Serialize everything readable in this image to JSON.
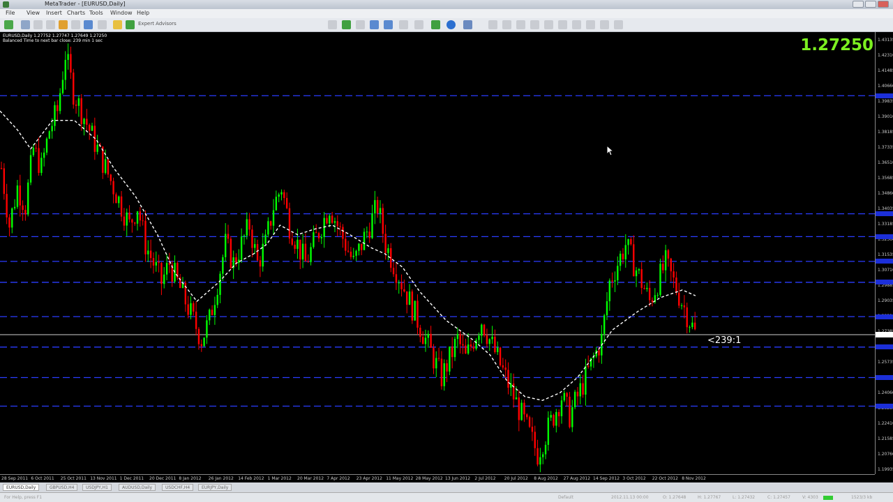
{
  "window": {
    "title": "MetaTrader - [EURUSD,Daily]",
    "menu": [
      "File",
      "View",
      "Insert",
      "Charts",
      "Tools",
      "Window",
      "Help"
    ],
    "toolbar_button": "Expert Advisors"
  },
  "chart_info": {
    "symbol_line": "EURUSD,Daily  1.27752 1.27747 1.27649 1.27250",
    "timer_line": "Balanced Time to next bar close: 239 min 1 sec",
    "big_price": "1.27250",
    "countdown": "<239:1"
  },
  "price_labels": [
    "1.43135",
    "1.42310",
    "1.41485",
    "1.40660",
    "1.39835",
    "1.39010",
    "1.38185",
    "1.37335",
    "1.36510",
    "1.35685",
    "1.34860",
    "1.34035",
    "1.33185",
    "1.32360",
    "1.31535",
    "1.30710",
    "1.29885",
    "1.29035",
    "1.28210",
    "1.27385",
    "1.26560",
    "1.25735",
    "1.24910",
    "1.24060",
    "1.23235",
    "1.22410",
    "1.21585",
    "1.20760",
    "1.19935"
  ],
  "time_labels": [
    "28 Sep 2011",
    "6 Oct 2011",
    "25 Oct 2011",
    "13 Nov 2011",
    "1 Dec 2011",
    "20 Dec 2011",
    "8 Jan 2012",
    "26 Jan 2012",
    "14 Feb 2012",
    "1 Mar 2012",
    "20 Mar 2012",
    "7 Apr 2012",
    "23 Apr 2012",
    "11 May 2012",
    "28 May 2012",
    "13 Jun 2012",
    "2 Jul 2012",
    "20 Jul 2012",
    "8 Aug 2012",
    "27 Aug 2012",
    "14 Sep 2012",
    "3 Oct 2012",
    "22 Oct 2012",
    "8 Nov 2012"
  ],
  "chart_data": {
    "type": "candlestick",
    "symbol": "EURUSD",
    "timeframe": "Daily",
    "current_price": 1.2725,
    "y_range": [
      1.1993,
      1.4314
    ],
    "horizontal_levels": [
      1.398,
      1.336,
      1.324,
      1.311,
      1.3,
      1.282,
      1.266,
      1.25,
      1.235
    ],
    "current_price_line": 1.2725,
    "moving_average_path": [
      [
        1.39,
        0
      ],
      [
        1.38,
        0.02
      ],
      [
        1.37,
        0.035
      ],
      [
        1.385,
        0.06
      ],
      [
        1.385,
        0.085
      ],
      [
        1.375,
        0.11
      ],
      [
        1.36,
        0.13
      ],
      [
        1.345,
        0.155
      ],
      [
        1.325,
        0.18
      ],
      [
        1.305,
        0.2
      ],
      [
        1.29,
        0.225
      ],
      [
        1.3,
        0.25
      ],
      [
        1.31,
        0.27
      ],
      [
        1.315,
        0.29
      ],
      [
        1.32,
        0.305
      ],
      [
        1.33,
        0.32
      ],
      [
        1.325,
        0.34
      ],
      [
        1.328,
        0.36
      ],
      [
        1.33,
        0.38
      ],
      [
        1.325,
        0.4
      ],
      [
        1.318,
        0.425
      ],
      [
        1.315,
        0.44
      ],
      [
        1.308,
        0.46
      ],
      [
        1.295,
        0.48
      ],
      [
        1.28,
        0.51
      ],
      [
        1.27,
        0.54
      ],
      [
        1.262,
        0.56
      ],
      [
        1.248,
        0.58
      ],
      [
        1.24,
        0.6
      ],
      [
        1.238,
        0.62
      ],
      [
        1.242,
        0.64
      ],
      [
        1.25,
        0.66
      ],
      [
        1.262,
        0.68
      ],
      [
        1.275,
        0.7
      ],
      [
        1.285,
        0.73
      ],
      [
        1.292,
        0.755
      ],
      [
        1.296,
        0.78
      ],
      [
        1.293,
        0.795
      ]
    ],
    "candles": [
      1.36,
      1.33,
      1.35,
      1.34,
      1.37,
      1.36,
      1.38,
      1.39,
      1.42,
      1.4,
      1.39,
      1.38,
      1.37,
      1.36,
      1.35,
      1.34,
      1.33,
      1.34,
      1.32,
      1.31,
      1.3,
      1.31,
      1.3,
      1.29,
      1.28,
      1.27,
      1.28,
      1.3,
      1.32,
      1.31,
      1.32,
      1.33,
      1.31,
      1.32,
      1.34,
      1.35,
      1.33,
      1.32,
      1.31,
      1.32,
      1.33,
      1.34,
      1.33,
      1.32,
      1.31,
      1.32,
      1.33,
      1.34,
      1.32,
      1.31,
      1.3,
      1.29,
      1.28,
      1.27,
      1.26,
      1.25,
      1.26,
      1.27,
      1.26,
      1.27,
      1.28,
      1.27,
      1.26,
      1.25,
      1.24,
      1.23,
      1.22,
      1.21,
      1.22,
      1.23,
      1.24,
      1.23,
      1.24,
      1.25,
      1.26,
      1.27,
      1.3,
      1.31,
      1.32,
      1.31,
      1.3,
      1.29,
      1.3,
      1.31,
      1.3,
      1.29,
      1.28,
      1.27
    ]
  },
  "tabs": [
    "EURUSD,Daily",
    "GBPUSD,H4",
    "USDJPY,H1",
    "AUDUSD,Daily",
    "USDCHF,H4",
    "EURJPY,Daily"
  ],
  "status": {
    "help": "For Help, press F1",
    "profile": "Default",
    "datetime": "2012.11.13 00:00",
    "o": "O: 1.27648",
    "h": "H: 1.27767",
    "l": "L: 1.27432",
    "c": "C: 1.27457",
    "v": "V: 4303",
    "traffic": "1523/3 kb"
  },
  "colors": {
    "bull": "#00ff00",
    "bear": "#ff0000",
    "levels": "#2a3cff",
    "ma": "#ffffff",
    "price_text": "#7cf020"
  }
}
